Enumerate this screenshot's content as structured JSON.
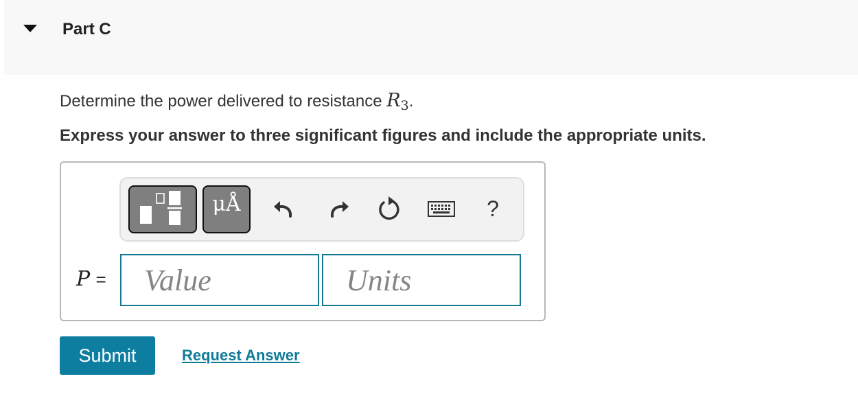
{
  "part": {
    "title": "Part C",
    "toggle_icon": "caret-down-icon"
  },
  "question": {
    "text": "Determine the power delivered to resistance ",
    "math_symbol": "R",
    "math_subscript": "3",
    "suffix": "."
  },
  "instruction": "Express your answer to three significant figures and include the appropriate units.",
  "toolbar": {
    "template_icon": "fraction-template-icon",
    "units_label": "μÅ",
    "undo_icon": "undo-icon",
    "redo_icon": "redo-icon",
    "reset_icon": "reset-icon",
    "keyboard_icon": "keyboard-icon",
    "help_label": "?"
  },
  "answer": {
    "variable": "P",
    "equals": "=",
    "value_placeholder": "Value",
    "units_placeholder": "Units"
  },
  "actions": {
    "submit_label": "Submit",
    "request_answer_label": "Request Answer"
  },
  "colors": {
    "header_bg": "#f8f8f8",
    "accent": "#0d7ea0",
    "field_border": "#157a91",
    "toolbar_button_bg": "#7f7f7f"
  }
}
